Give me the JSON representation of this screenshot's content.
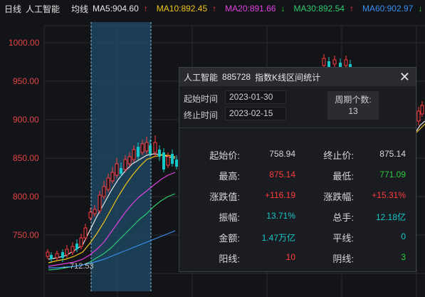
{
  "header": {
    "period": "日线",
    "name": "人工智能",
    "avg_label": "均线",
    "ma": [
      {
        "label": "MA5:904.60",
        "arrow": "↑",
        "color": "#e6e6e6",
        "arrow_color": "#ff3b3b"
      },
      {
        "label": "MA10:892.45",
        "arrow": "↑",
        "color": "#f0c419",
        "arrow_color": "#ff3b3b"
      },
      {
        "label": "MA20:891.66",
        "arrow": "↓",
        "color": "#e040e0",
        "arrow_color": "#2ecc40"
      },
      {
        "label": "MA30:892.54",
        "arrow": "↑",
        "color": "#2ecc71",
        "arrow_color": "#ff3b3b"
      },
      {
        "label": "MA60:902.97",
        "arrow": "↓",
        "color": "#3a8ff0",
        "arrow_color": "#2ecc40"
      }
    ]
  },
  "y_axis": [
    "1000.00",
    "950.00",
    "900.00",
    "850.00",
    "800.00",
    "750.00"
  ],
  "low_marker": "712.53",
  "colors": {
    "up": "#ff3b3b",
    "down": "#16c7c7",
    "highlight": "#1f4c69"
  },
  "popup": {
    "title_name": "人工智能",
    "title_code": "885728",
    "title_text": "指数K线区间统计",
    "close": "✕",
    "start_label": "起始时间",
    "start_value": "2023-01-30",
    "end_label": "终止时间",
    "end_value": "2023-02-15",
    "period_label": "周期个数:",
    "period_value": "13",
    "stats": {
      "start_price_label": "起始价:",
      "start_price": "758.94",
      "end_price_label": "终止价:",
      "end_price": "875.14",
      "high_label": "最高:",
      "high": "875.14",
      "low_label": "最低:",
      "low": "771.09",
      "change_label": "涨跌值:",
      "change": "+116.19",
      "change_pct_label": "涨跌幅:",
      "change_pct": "+15.31%",
      "amplitude_label": "振幅:",
      "amplitude": "13.71%",
      "total_hand_label": "总手:",
      "total_hand": "12.18亿",
      "amount_label": "金额:",
      "amount": "1.47万亿",
      "flat_label": "平线:",
      "flat": "0",
      "up_label": "阳线:",
      "up": "10",
      "down_label": "阴线:",
      "down": "3"
    }
  }
}
